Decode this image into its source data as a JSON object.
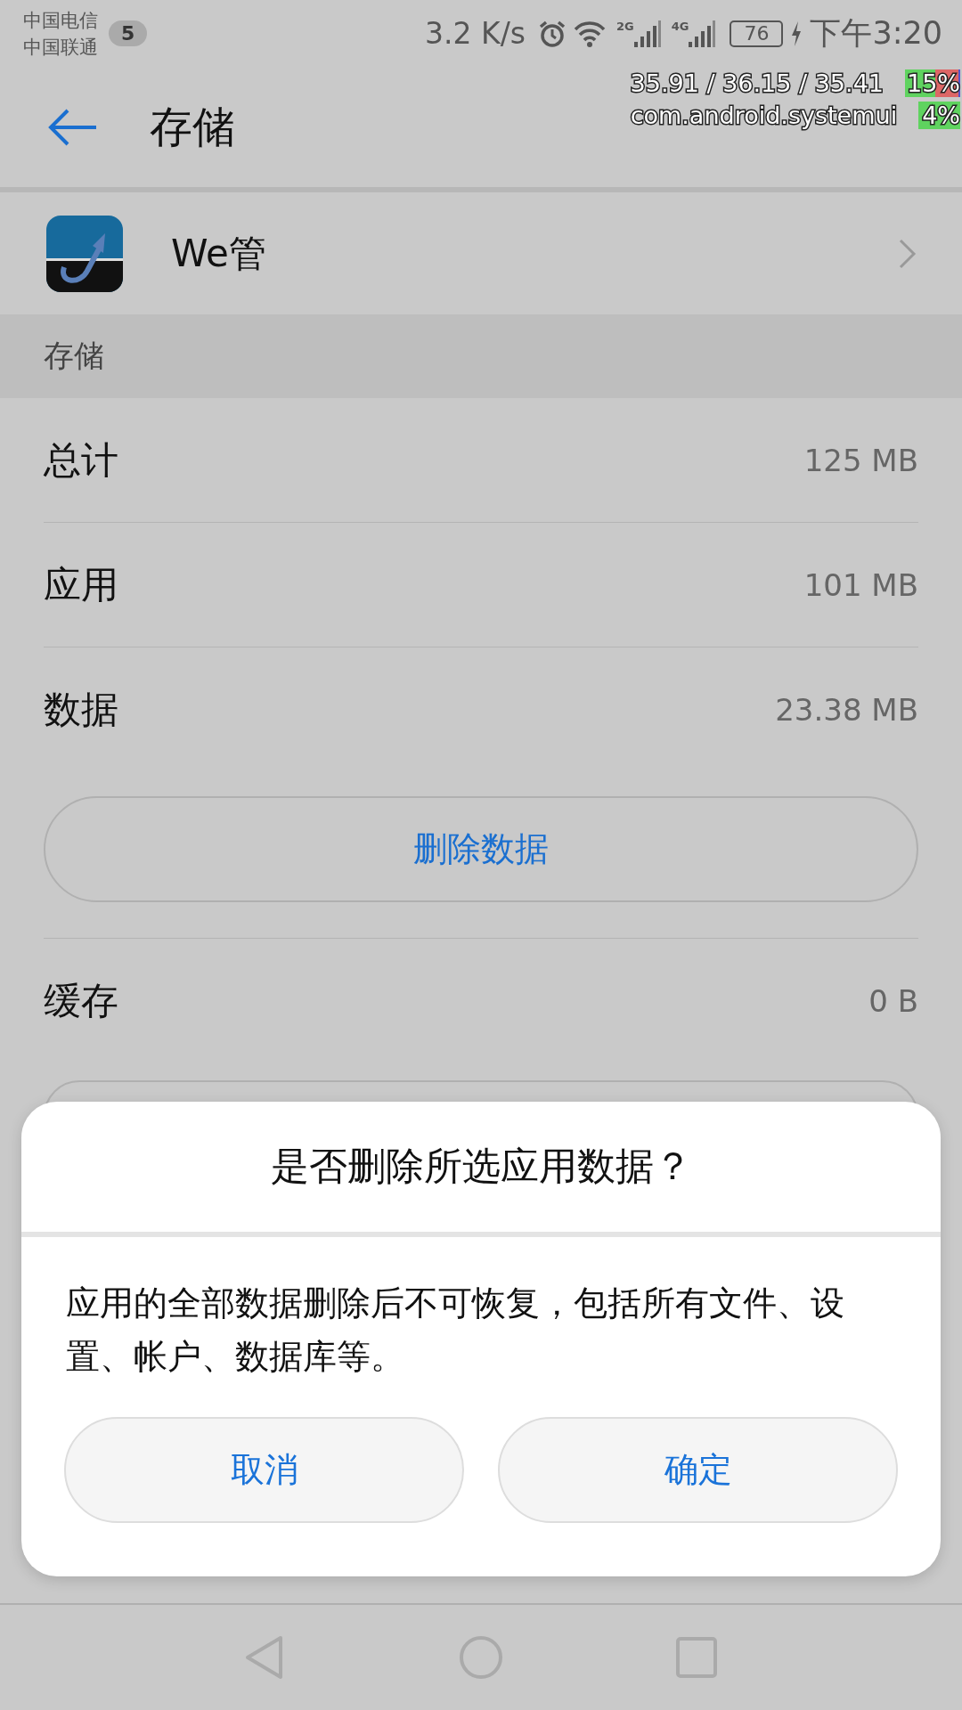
{
  "status_bar": {
    "carriers": [
      "中国电信",
      "中国联通"
    ],
    "badge": "5",
    "speed": "3.2 K/s",
    "signals": [
      {
        "label": "2G"
      },
      {
        "label": "4G"
      }
    ],
    "battery": "76",
    "time": "下午3:20"
  },
  "overlay": [
    {
      "text": "35.91 / 36.15 / 35.41",
      "percent": "15%"
    },
    {
      "text": "com.android.systemui",
      "percent": "4%"
    }
  ],
  "toolbar": {
    "title": "存储"
  },
  "app": {
    "name": "We管"
  },
  "section": {
    "title": "存储"
  },
  "rows": [
    {
      "label": "总计",
      "value": "125 MB"
    },
    {
      "label": "应用",
      "value": "101 MB"
    },
    {
      "label": "数据",
      "value": "23.38 MB"
    }
  ],
  "action_button": "删除数据",
  "cache_row": {
    "label": "缓存",
    "value": "0 B"
  },
  "dialog": {
    "title": "是否删除所选应用数据？",
    "message": "应用的全部数据删除后不可恢复，包括所有文件、设置、帐户、数据库等。",
    "buttons": [
      "取消",
      "确定"
    ]
  }
}
